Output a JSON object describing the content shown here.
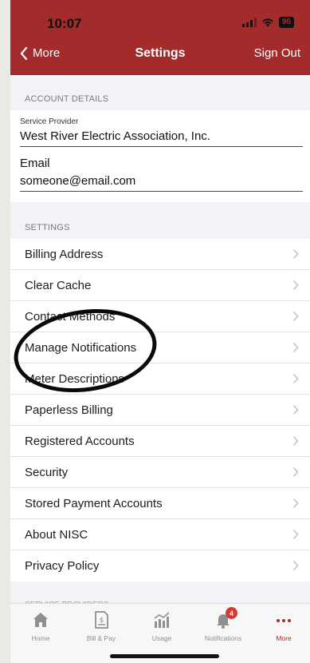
{
  "status_bar": {
    "time": "10:07",
    "battery": "96"
  },
  "nav": {
    "back_label": "More",
    "title": "Settings",
    "sign_out": "Sign Out"
  },
  "account_details": {
    "section_title": "ACCOUNT DETAILS",
    "service_provider_label": "Service Provider",
    "service_provider_value": "West River Electric Association, Inc.",
    "email_label": "Email",
    "email_value": "someone@email.com"
  },
  "settings": {
    "section_title": "SETTINGS",
    "items": [
      {
        "label": "Billing Address"
      },
      {
        "label": "Clear Cache"
      },
      {
        "label": "Contact Methods"
      },
      {
        "label": "Manage Notifications"
      },
      {
        "label": "Meter Descriptions"
      },
      {
        "label": "Paperless Billing"
      },
      {
        "label": "Registered Accounts"
      },
      {
        "label": "Security"
      },
      {
        "label": "Stored Payment Accounts"
      },
      {
        "label": "About NISC"
      },
      {
        "label": "Privacy Policy"
      }
    ]
  },
  "service_providers": {
    "section_title": "SERVICE PROVIDERS"
  },
  "tabbar": {
    "tabs": [
      {
        "label": "Home",
        "icon": "home-icon"
      },
      {
        "label": "Bill & Pay",
        "icon": "bill-icon"
      },
      {
        "label": "Usage",
        "icon": "usage-chart-icon"
      },
      {
        "label": "Notifications",
        "icon": "bell-icon",
        "badge": "4"
      },
      {
        "label": "More",
        "icon": "more-dots-icon",
        "active": true
      }
    ]
  },
  "colors": {
    "brand": "#a32b2b",
    "badge": "#d8382f"
  }
}
